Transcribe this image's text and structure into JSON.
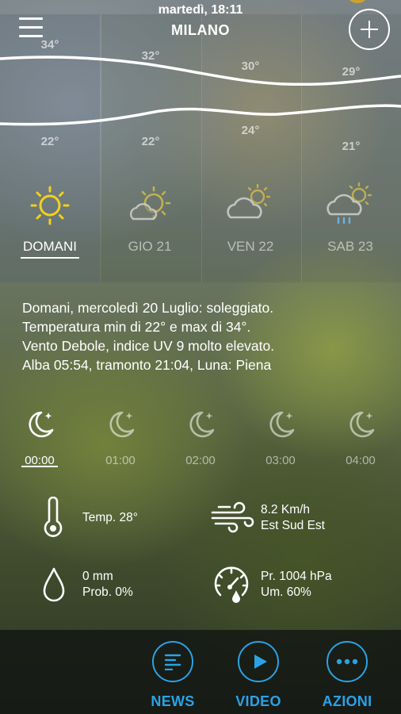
{
  "header": {
    "datetime": "martedì, 18:11",
    "city": "MILANO"
  },
  "days": [
    {
      "label": "DOMANI",
      "max": "34°",
      "min": "22°",
      "icon": "sun-icon",
      "selected": true
    },
    {
      "label": "GIO 21",
      "max": "32°",
      "min": "22°",
      "icon": "sun-cloud-icon",
      "selected": false
    },
    {
      "label": "VEN 22",
      "max": "30°",
      "min": "24°",
      "icon": "cloud-sun-icon",
      "selected": false
    },
    {
      "label": "SAB 23",
      "max": "29°",
      "min": "21°",
      "icon": "cloud-sun-rain-icon",
      "selected": false
    }
  ],
  "description": {
    "line1": "Domani, mercoledì 20 Luglio: soleggiato.",
    "line2": "Temperatura min di 22° e max di 34°.",
    "line3": "Vento Debole, indice UV 9 molto elevato.",
    "line4": "Alba 05:54, tramonto 21:04, Luna: Piena"
  },
  "hours": [
    {
      "time": "00:00",
      "icon": "moon-icon",
      "selected": true
    },
    {
      "time": "01:00",
      "icon": "moon-icon",
      "selected": false
    },
    {
      "time": "02:00",
      "icon": "moon-icon",
      "selected": false
    },
    {
      "time": "03:00",
      "icon": "moon-icon",
      "selected": false
    },
    {
      "time": "04:00",
      "icon": "moon-icon",
      "selected": false
    }
  ],
  "details": {
    "temp": "Temp. 28°",
    "wind_speed": "8.2 Km/h",
    "wind_dir": "Est Sud Est",
    "rain": "0 mm",
    "prob": "Prob. 0%",
    "pressure": "Pr. 1004 hPa",
    "humidity": "Um. 60%"
  },
  "nav": {
    "news": "NEWS",
    "video": "VIDEO",
    "actions": "AZIONI"
  },
  "colors": {
    "accent": "#2aa2e6",
    "sun": "#f2d11a"
  }
}
